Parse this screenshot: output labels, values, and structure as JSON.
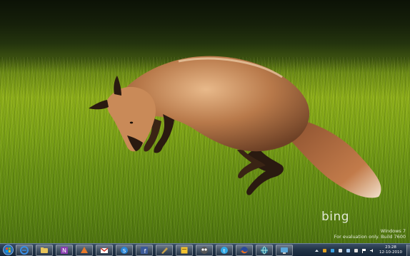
{
  "wallpaper": {
    "subject": "red fox leaping over grass",
    "brand_logo_text": "bing",
    "watermark": {
      "line1": "Windows 7",
      "line2": "For evaluation only. Build 7600"
    }
  },
  "taskbar": {
    "start": {
      "icon": "windows-orb-icon"
    },
    "pinned": [
      {
        "name": "ie",
        "icon": "internet-explorer-icon",
        "color": "#3a8ee6"
      },
      {
        "name": "explorer",
        "icon": "folder-icon",
        "color": "#e8c45a"
      },
      {
        "name": "onenote",
        "icon": "onenote-icon",
        "color": "#8a3fb0"
      },
      {
        "name": "paint",
        "icon": "paint-icon",
        "color": "#e87a2a"
      },
      {
        "name": "mail",
        "icon": "mail-icon",
        "color": "#d23a2a"
      },
      {
        "name": "skype",
        "icon": "skype-icon",
        "color": "#2a86d8"
      },
      {
        "name": "facebook",
        "icon": "facebook-icon",
        "color": "#3b5998"
      },
      {
        "name": "tool",
        "icon": "pencil-icon",
        "color": "#c8a24a"
      },
      {
        "name": "sticky",
        "icon": "sticky-note-icon",
        "color": "#f2c230"
      },
      {
        "name": "owl",
        "icon": "owl-icon",
        "color": "#555555"
      },
      {
        "name": "twitter",
        "icon": "twitter-icon",
        "color": "#32a9e6"
      },
      {
        "name": "firefox",
        "icon": "firefox-icon",
        "color": "#e8701a"
      },
      {
        "name": "globe",
        "icon": "globe-icon",
        "color": "#2a7a9a"
      },
      {
        "name": "network",
        "icon": "network-icon",
        "color": "#5aa6d8"
      }
    ],
    "tray": {
      "icons": [
        "show-hidden-icons-icon",
        "tray-app-icon",
        "tray-app-icon",
        "tray-app-icon",
        "tray-app-icon",
        "tray-app-icon",
        "flag-icon",
        "volume-icon"
      ],
      "time": "23:28",
      "date": "12-10-2010"
    }
  }
}
